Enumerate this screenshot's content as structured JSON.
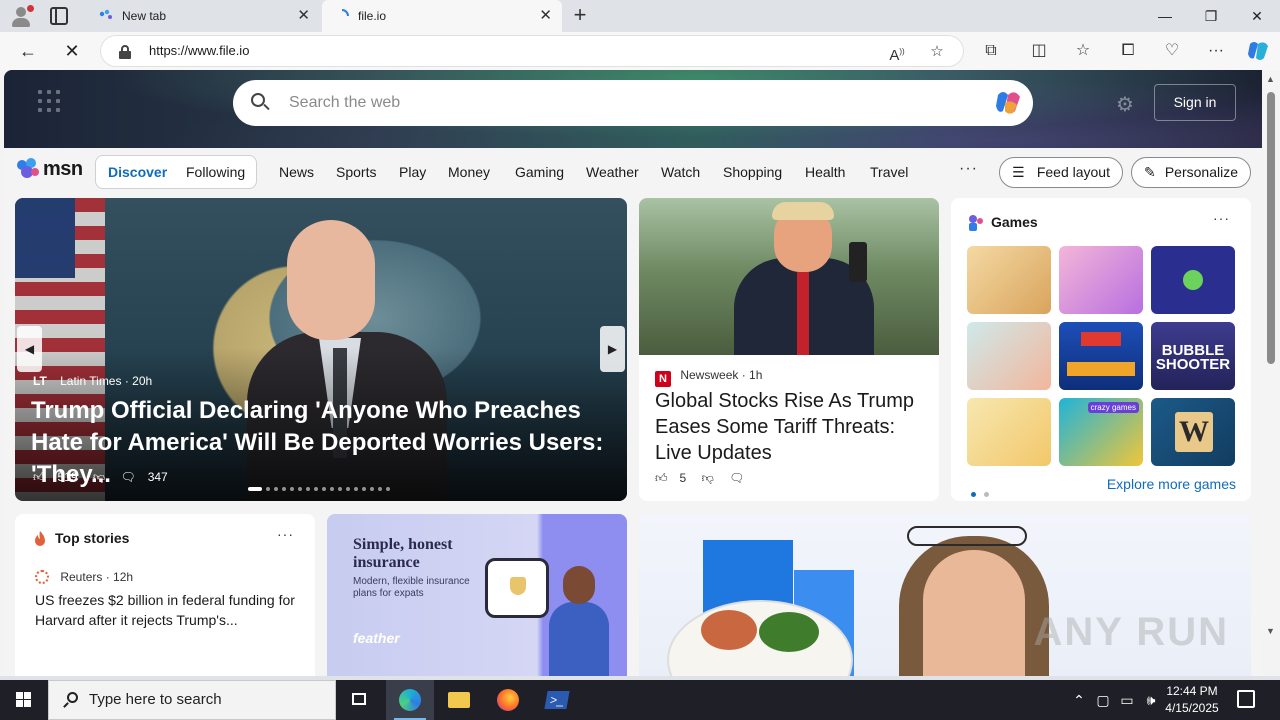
{
  "browser": {
    "tabs": [
      {
        "label": "New tab",
        "close": "✕"
      },
      {
        "label": "file.io",
        "close": "✕"
      }
    ],
    "new_tab": "+",
    "window_controls": {
      "minimize": "—",
      "restore": "❐",
      "close": "✕"
    },
    "address_url": "https://www.file.io",
    "accent": "#0f6cbd"
  },
  "msn_header": {
    "search_placeholder": "Search the web",
    "sign_in": "Sign in"
  },
  "msn_nav": {
    "logo_text": "msn",
    "pills": [
      "Discover",
      "Following"
    ],
    "links": [
      "News",
      "Sports",
      "Play",
      "Money",
      "Gaming",
      "Weather",
      "Watch",
      "Shopping",
      "Health",
      "Travel"
    ],
    "more": "···",
    "feed_layout": "Feed layout",
    "personalize": "Personalize"
  },
  "hero": {
    "source_logo": "LT",
    "source": "Latin Times",
    "age": "· 20h",
    "headline": "Trump Official Declaring 'Anyone Who Preaches Hate for America' Will Be Deported Worries Users: 'They...",
    "likes": "519",
    "comments": "347"
  },
  "news": {
    "source_logo": "N",
    "source": "Newsweek",
    "age": "· 1h",
    "headline": "Global Stocks Rise As Trump Eases Some Tariff Threats: Live Updates",
    "likes": "5"
  },
  "games": {
    "title": "Games",
    "more": "···",
    "explore": "Explore more games",
    "tile_labels": {
      "bubble": "BUBBLE SHOOTER",
      "crazy": "crazy games",
      "words": "W"
    }
  },
  "top_stories": {
    "title": "Top stories",
    "more": "···",
    "source": "Reuters",
    "age": "· 12h",
    "headline": "US freezes $2 billion in federal funding for Harvard after it rejects Trump's..."
  },
  "ad": {
    "title": "Simple, honest insurance",
    "subtitle": "Modern, flexible insurance plans for expats",
    "brand": "feather"
  },
  "watermark": "ANY RUN",
  "taskbar": {
    "search_placeholder": "Type here to search",
    "time": "12:44 PM",
    "date": "4/15/2025"
  }
}
